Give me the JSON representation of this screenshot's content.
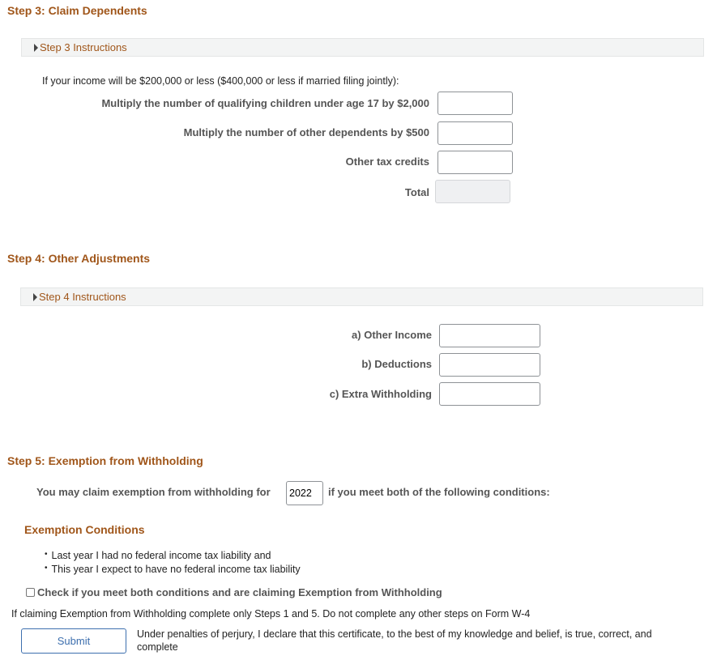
{
  "step3": {
    "title": "Step 3: Claim Dependents",
    "instructions_label": "Step 3 Instructions",
    "intro": "If your income will be $200,000 or less ($400,000 or less if married filing jointly):",
    "fields": [
      {
        "label": "Multiply the number of qualifying children under age 17 by $2,000",
        "value": ""
      },
      {
        "label": "Multiply the number of other dependents by $500",
        "value": ""
      },
      {
        "label": "Other tax credits",
        "value": ""
      },
      {
        "label": "Total",
        "value": "",
        "disabled": true
      }
    ]
  },
  "step4": {
    "title": "Step 4: Other Adjustments",
    "instructions_label": "Step 4 Instructions",
    "fields": [
      {
        "label": "a) Other Income",
        "value": ""
      },
      {
        "label": "b) Deductions",
        "value": ""
      },
      {
        "label": "c) Extra Withholding",
        "value": ""
      }
    ]
  },
  "step5": {
    "title": "Step 5: Exemption from Withholding",
    "claim_prefix": "You may claim exemption from withholding for",
    "year": "2022",
    "claim_suffix": "if you meet both of the following conditions:",
    "conditions_title": "Exemption Conditions",
    "conditions": [
      "Last year I had no federal income tax liability and",
      "This year I expect to have no federal income tax liability"
    ],
    "checkbox_label": "Check if you meet both conditions and are claiming Exemption from Withholding",
    "checkbox_checked": false,
    "note": "If claiming Exemption from Withholding complete only Steps 1 and 5. Do not complete any other steps on Form W-4"
  },
  "footer": {
    "submit_label": "Submit",
    "declaration": "Under penalties of perjury, I declare that this certificate, to the best of my knowledge and belief, is true, correct, and complete"
  }
}
